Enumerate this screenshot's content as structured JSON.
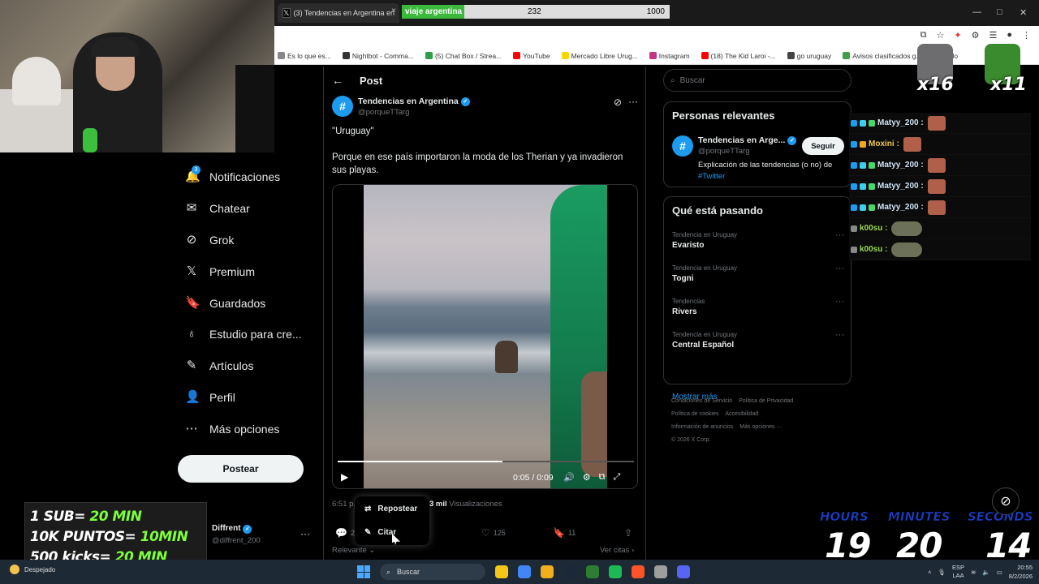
{
  "browser": {
    "tab_title": "(3) Tendencias en Argentina en",
    "tab_close": "×",
    "goal": {
      "label": "viaje argentina",
      "current": "232",
      "max": "1000",
      "progress": 0.232
    },
    "window_controls": [
      "—",
      "□",
      "✕"
    ],
    "bookmarks": [
      {
        "label": "Es lo que es...",
        "color": "#888888"
      },
      {
        "label": "Nightbot - Comma...",
        "color": "#333333"
      },
      {
        "label": "(5) Chat Box / Strea...",
        "color": "#2e9e4a"
      },
      {
        "label": "YouTube",
        "color": "#ff0000"
      },
      {
        "label": "Mercado Libre Urug...",
        "color": "#f5d800"
      },
      {
        "label": "Instagram",
        "color": "#c13584"
      },
      {
        "label": "(18) The Kid Laroi -...",
        "color": "#ff0000"
      },
      {
        "label": "go uruguay",
        "color": "#444444"
      },
      {
        "label": "Avisos clasificados g...",
        "color": "#3aa14a"
      },
      {
        "label": "Todo",
        "color": "#999999"
      }
    ]
  },
  "nav": {
    "notif_badge": "3",
    "items": [
      {
        "label": "Notificaciones",
        "icon": "🔔"
      },
      {
        "label": "Chatear",
        "icon": "✉"
      },
      {
        "label": "Grok",
        "icon": "⊘"
      },
      {
        "label": "Premium",
        "icon": "𝕏"
      },
      {
        "label": "Guardados",
        "icon": "🔖"
      },
      {
        "label": "Estudio para cre...",
        "icon": "♁"
      },
      {
        "label": "Artículos",
        "icon": "✎"
      },
      {
        "label": "Perfil",
        "icon": "👤"
      },
      {
        "label": "Más opciones",
        "icon": "⋯"
      }
    ],
    "post_button": "Postear",
    "profile_name": "Diffrent",
    "profile_handle": "@diffrent_200",
    "profile_more": "···"
  },
  "stream_panel": {
    "line1_a": "1 SUB= ",
    "line1_b": "20 MIN",
    "line2_a": "10K PUNTOS= ",
    "line2_b": "10MIN",
    "line3_a": "500 kicks= ",
    "line3_b": "20 MIN"
  },
  "post": {
    "header": "Post",
    "back": "←",
    "avatar": "#",
    "author": "Tendencias en Argentina",
    "handle": "@porqueTTarg",
    "more": "···",
    "text1": "\"Uruguay\"",
    "text2": "Porque en ese país importaron la moda de los Therian y ya invadieron sus playas.",
    "video": {
      "time": "0:05 / 0:09",
      "progress": 0.556
    },
    "time": "6:51 p.",
    "views_count": "3 mil",
    "views_label": "Visualizaciones",
    "replies": "23",
    "likes": "125",
    "bookmarks": "11",
    "sort": "Relevante",
    "quotes": "Ver citas"
  },
  "popup": {
    "repost": "Repostear",
    "quote": "Citar"
  },
  "sidebar": {
    "search_placeholder": "Buscar",
    "relevant_title": "Personas relevantes",
    "rel_avatar": "#",
    "rel_name": "Tendencias en Arge...",
    "rel_handle": "@porqueTTarg",
    "follow": "Seguir",
    "rel_bio": "Explicación de las tendencias (o no) de",
    "rel_bio_hash": "#Twitter",
    "trending_title": "Qué está pasando",
    "trends": [
      {
        "category": "Tendencia en Uruguay",
        "name": "Evaristo"
      },
      {
        "category": "Tendencia en Uruguay",
        "name": "Togni"
      },
      {
        "category": "Tendencias",
        "name": "Rivers"
      },
      {
        "category": "Tendencia en Uruguay",
        "name": "Central Español"
      }
    ],
    "show_more": "Mostrar más",
    "footer": [
      "Condiciones de Servicio",
      "Política de Privacidad",
      "Política de cookies",
      "Accesibilidad",
      "Información de anuncios",
      "Más opciones ···",
      "© 2026 X Corp."
    ]
  },
  "overlay": {
    "emote1_count": "x16",
    "emote2_count": "x11",
    "chat": [
      {
        "user": "Matyy_200 :",
        "color": "#cfe3f5",
        "emote": "red"
      },
      {
        "user": "Moxini :",
        "color": "#f2c94c",
        "emote": "red"
      },
      {
        "user": "Matyy_200 :",
        "color": "#cfe3f5",
        "emote": "red"
      },
      {
        "user": "Matyy_200 :",
        "color": "#cfe3f5",
        "emote": "red"
      },
      {
        "user": "Matyy_200 :",
        "color": "#cfe3f5",
        "emote": "red"
      },
      {
        "user": "k00su :",
        "color": "#9ad84f",
        "emote": "gray"
      },
      {
        "user": "k00su :",
        "color": "#9ad84f",
        "emote": "gray"
      }
    ],
    "timer": {
      "hours_label": "HOURS",
      "minutes_label": "MINUTES",
      "seconds_label": "SECONDS",
      "hours": "19",
      "minutes": "20",
      "seconds": "14"
    }
  },
  "taskbar": {
    "weather": "Despejado",
    "search": "Buscar",
    "lang1": "ESP",
    "lang2": "LAA",
    "time": "20:55",
    "date": "8/2/2026",
    "apps": [
      "#f5c518",
      "#4285f4",
      "#f2b01e",
      "#1b2838",
      "#2e7d32",
      "#1db954",
      "#fb542b",
      "#9e9e9e",
      "#5865f2"
    ]
  }
}
